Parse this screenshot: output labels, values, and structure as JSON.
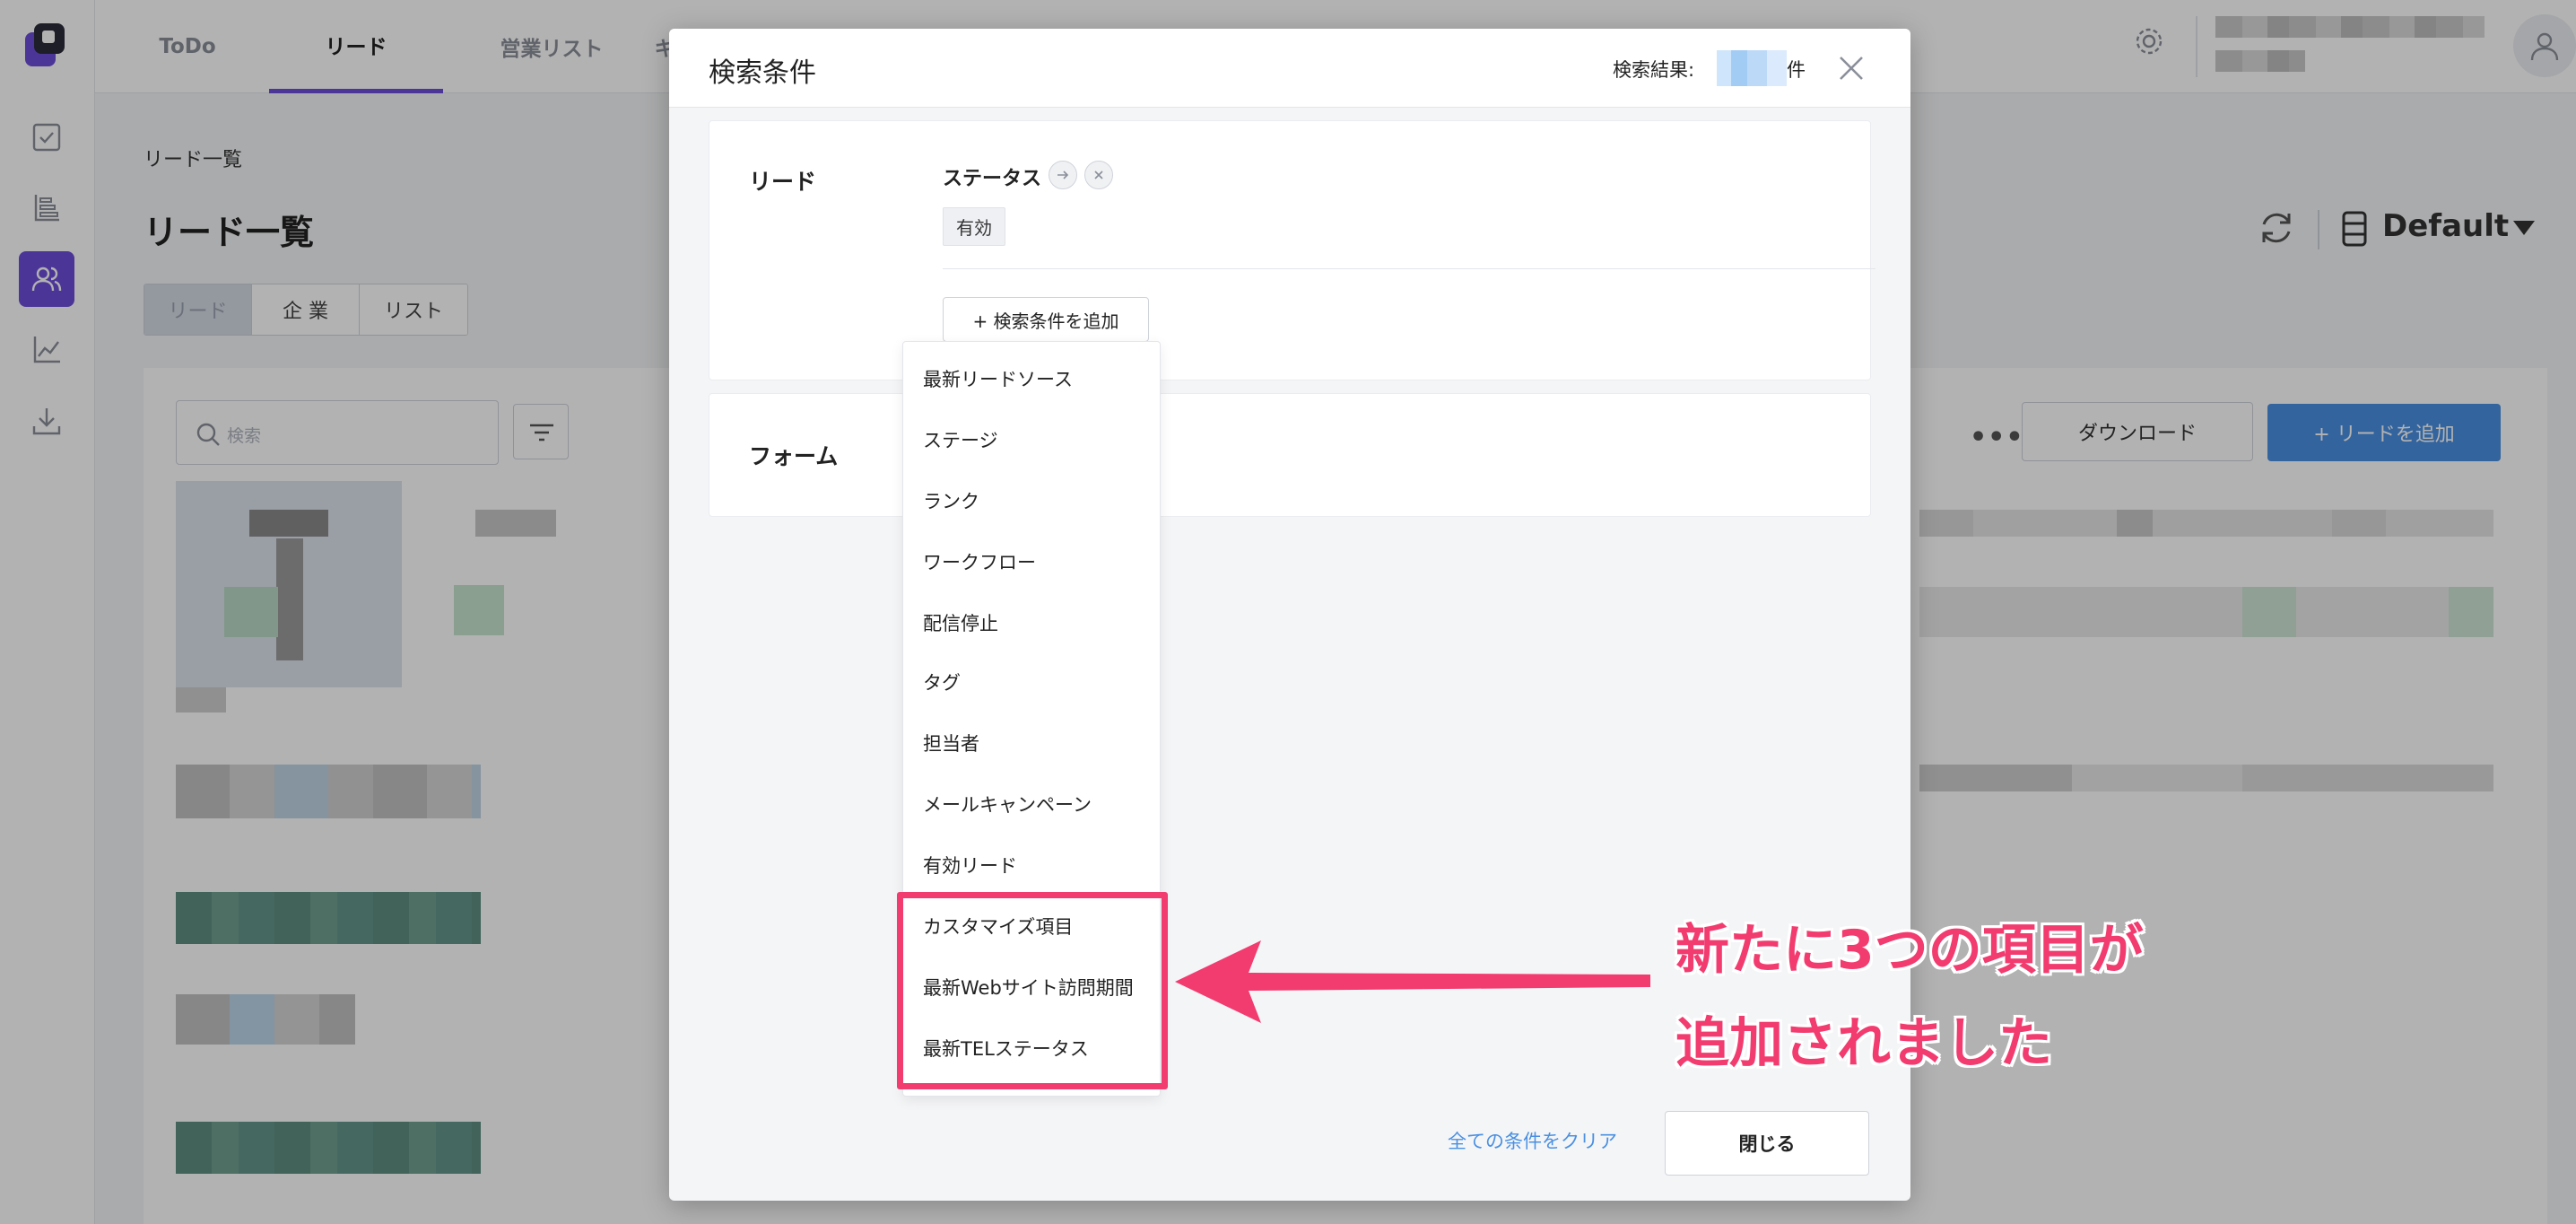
{
  "topbar": {
    "tabs": [
      "ToDo",
      "リード",
      "営業リスト",
      "キ"
    ]
  },
  "page": {
    "breadcrumb": "リード一覧",
    "title": "リード一覧",
    "segments": [
      "リード",
      "企 業",
      "リスト"
    ],
    "view_name": "Default",
    "search_placeholder": "検索",
    "more_label": "•••",
    "download_label": "ダウンロード",
    "add_lead_label": "+ リードを追加"
  },
  "modal": {
    "title": "検索条件",
    "result_label": "検索結果:",
    "result_unit": "件",
    "section_lead": "リード",
    "section_form": "フォーム",
    "condition_name": "ステータス",
    "condition_value": "有効",
    "add_condition_label": "+ 検索条件を追加",
    "dropdown_items": [
      "最新リードソース",
      "ステージ",
      "ランク",
      "ワークフロー",
      "配信停止",
      "タグ",
      "担当者",
      "メールキャンペーン",
      "有効リード",
      "カスタマイズ項目",
      "最新Webサイト訪問期間",
      "最新TELステータス"
    ],
    "clear_all_label": "全ての条件をクリア",
    "close_label": "閉じる"
  },
  "annotation": {
    "line1": "新たに3つの項目が",
    "line2": "追加されました",
    "color": "#f23b6f"
  },
  "colors": {
    "accent": "#6c4cd8",
    "primary_button": "#4a90e2",
    "link": "#4a90e2"
  }
}
